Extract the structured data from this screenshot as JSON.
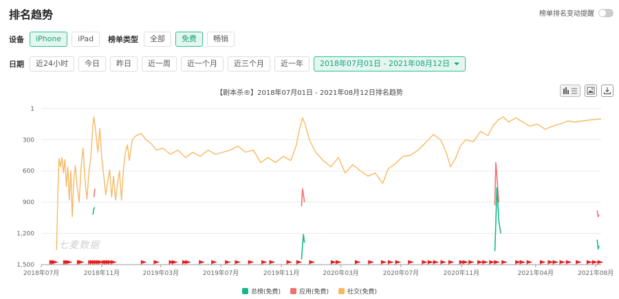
{
  "header": {
    "title": "排名趋势",
    "alert_label": "榜单排名变动提醒"
  },
  "device": {
    "label": "设备",
    "options": [
      "iPhone",
      "iPad"
    ],
    "active": 0
  },
  "list_type": {
    "label": "榜单类型",
    "options": [
      "全部",
      "免费",
      "畅销"
    ],
    "active": 1
  },
  "date": {
    "label": "日期",
    "options": [
      "近24小时",
      "今日",
      "昨日",
      "近一周",
      "近一个月",
      "近三个月",
      "近一年"
    ],
    "range": "2018年07月01日 - 2021年08月12日"
  },
  "watermark": "七麦数据",
  "icons": {
    "chart_toggle": "bar-list-toggle-icon",
    "image": "image-icon",
    "download": "download-icon"
  },
  "colors": {
    "accent": "#2ebd94",
    "overall": "#14b88a",
    "app": "#f0716e",
    "social": "#f8b862"
  },
  "chart_data": {
    "type": "line",
    "title": "【剧本杀®】2018年07月01日 - 2021年08月12日排名趋势",
    "xlabel": "",
    "ylabel": "",
    "y_inverted": true,
    "ylim": [
      1,
      1500
    ],
    "yticks": [
      1,
      300,
      600,
      900,
      1200,
      1500
    ],
    "ytick_labels": [
      "1",
      "300",
      "600",
      "900",
      "1,200",
      "1,500"
    ],
    "xticks": [
      "2018-07-01",
      "2018-11-01",
      "2019-03-01",
      "2019-07-01",
      "2019-11-01",
      "2020-03-01",
      "2020-07-01",
      "2020-11-01",
      "2021-04-01",
      "2021-08-01"
    ],
    "xtick_labels": [
      "2018年07月",
      "2018年11月",
      "2019年03月",
      "2019年07月",
      "2019年11月",
      "2020年03月",
      "2020年07月",
      "2020年11月",
      "2021年04月",
      "2021年08月"
    ],
    "xlim": [
      "2018-07-01",
      "2021-08-12"
    ],
    "grid": "horizontal",
    "legend_position": "bottom",
    "series": [
      {
        "name": "总榜(免费)",
        "color": "#14b88a",
        "segments": [
          [
            [
              "2018-10-14",
              1020
            ],
            [
              "2018-10-16",
              960
            ],
            [
              "2018-10-18",
              950
            ]
          ],
          [
            [
              "2019-12-12",
              1450
            ],
            [
              "2019-12-14",
              1320
            ],
            [
              "2019-12-16",
              1210
            ],
            [
              "2019-12-18",
              1290
            ]
          ],
          [
            [
              "2021-01-08",
              1370
            ],
            [
              "2021-01-10",
              1100
            ],
            [
              "2021-01-12",
              760
            ],
            [
              "2021-01-14",
              900
            ],
            [
              "2021-01-16",
              1080
            ],
            [
              "2021-01-20",
              1200
            ]
          ],
          [
            [
              "2021-08-04",
              1260
            ],
            [
              "2021-08-06",
              1350
            ],
            [
              "2021-08-08",
              1320
            ]
          ]
        ]
      },
      {
        "name": "应用(免费)",
        "color": "#f0716e",
        "segments": [
          [
            [
              "2018-10-16",
              850
            ],
            [
              "2018-10-18",
              770
            ]
          ],
          [
            [
              "2019-12-12",
              940
            ],
            [
              "2019-12-14",
              770
            ],
            [
              "2019-12-16",
              830
            ],
            [
              "2019-12-18",
              900
            ]
          ],
          [
            [
              "2021-01-08",
              930
            ],
            [
              "2021-01-10",
              520
            ],
            [
              "2021-01-12",
              640
            ],
            [
              "2021-01-14",
              780
            ],
            [
              "2021-01-16",
              900
            ]
          ],
          [
            [
              "2021-08-04",
              980
            ],
            [
              "2021-08-06",
              1040
            ],
            [
              "2021-08-08",
              1020
            ]
          ]
        ]
      },
      {
        "name": "社交(免费)",
        "color": "#f8b862",
        "points": [
          [
            "2018-08-01",
            1360
          ],
          [
            "2018-08-04",
            780
          ],
          [
            "2018-08-06",
            480
          ],
          [
            "2018-08-09",
            560
          ],
          [
            "2018-08-12",
            470
          ],
          [
            "2018-08-15",
            620
          ],
          [
            "2018-08-18",
            490
          ],
          [
            "2018-08-21",
            750
          ],
          [
            "2018-08-24",
            560
          ],
          [
            "2018-08-27",
            880
          ],
          [
            "2018-08-30",
            600
          ],
          [
            "2018-09-02",
            1040
          ],
          [
            "2018-09-05",
            700
          ],
          [
            "2018-09-08",
            550
          ],
          [
            "2018-09-12",
            750
          ],
          [
            "2018-09-16",
            900
          ],
          [
            "2018-09-20",
            560
          ],
          [
            "2018-09-24",
            380
          ],
          [
            "2018-09-28",
            700
          ],
          [
            "2018-10-02",
            870
          ],
          [
            "2018-10-06",
            600
          ],
          [
            "2018-10-10",
            460
          ],
          [
            "2018-10-14",
            160
          ],
          [
            "2018-10-16",
            80
          ],
          [
            "2018-10-20",
            230
          ],
          [
            "2018-10-24",
            420
          ],
          [
            "2018-10-28",
            190
          ],
          [
            "2018-11-01",
            480
          ],
          [
            "2018-11-05",
            640
          ],
          [
            "2018-11-09",
            830
          ],
          [
            "2018-11-13",
            700
          ],
          [
            "2018-11-17",
            590
          ],
          [
            "2018-11-21",
            850
          ],
          [
            "2018-11-25",
            650
          ],
          [
            "2018-11-29",
            880
          ],
          [
            "2018-12-03",
            720
          ],
          [
            "2018-12-07",
            600
          ],
          [
            "2018-12-11",
            880
          ],
          [
            "2018-12-15",
            580
          ],
          [
            "2018-12-19",
            420
          ],
          [
            "2018-12-23",
            350
          ],
          [
            "2018-12-27",
            500
          ],
          [
            "2019-01-02",
            300
          ],
          [
            "2019-01-10",
            260
          ],
          [
            "2019-01-20",
            240
          ],
          [
            "2019-01-30",
            300
          ],
          [
            "2019-02-10",
            340
          ],
          [
            "2019-02-20",
            400
          ],
          [
            "2019-03-05",
            380
          ],
          [
            "2019-03-20",
            440
          ],
          [
            "2019-04-05",
            400
          ],
          [
            "2019-04-20",
            470
          ],
          [
            "2019-05-05",
            420
          ],
          [
            "2019-05-20",
            460
          ],
          [
            "2019-06-05",
            400
          ],
          [
            "2019-06-20",
            440
          ],
          [
            "2019-07-05",
            420
          ],
          [
            "2019-07-20",
            400
          ],
          [
            "2019-08-05",
            360
          ],
          [
            "2019-08-20",
            420
          ],
          [
            "2019-09-05",
            400
          ],
          [
            "2019-09-20",
            520
          ],
          [
            "2019-10-05",
            470
          ],
          [
            "2019-10-20",
            520
          ],
          [
            "2019-11-05",
            460
          ],
          [
            "2019-11-20",
            500
          ],
          [
            "2019-12-01",
            360
          ],
          [
            "2019-12-08",
            200
          ],
          [
            "2019-12-14",
            90
          ],
          [
            "2019-12-20",
            160
          ],
          [
            "2019-12-28",
            300
          ],
          [
            "2020-01-10",
            420
          ],
          [
            "2020-01-25",
            500
          ],
          [
            "2020-02-10",
            560
          ],
          [
            "2020-02-25",
            470
          ],
          [
            "2020-03-10",
            620
          ],
          [
            "2020-03-25",
            540
          ],
          [
            "2020-04-10",
            600
          ],
          [
            "2020-04-25",
            650
          ],
          [
            "2020-05-10",
            620
          ],
          [
            "2020-05-25",
            720
          ],
          [
            "2020-06-05",
            580
          ],
          [
            "2020-06-20",
            530
          ],
          [
            "2020-07-05",
            460
          ],
          [
            "2020-07-20",
            450
          ],
          [
            "2020-08-05",
            400
          ],
          [
            "2020-08-20",
            330
          ],
          [
            "2020-09-05",
            250
          ],
          [
            "2020-09-20",
            300
          ],
          [
            "2020-10-01",
            420
          ],
          [
            "2020-10-10",
            560
          ],
          [
            "2020-10-20",
            480
          ],
          [
            "2020-10-30",
            360
          ],
          [
            "2020-11-10",
            300
          ],
          [
            "2020-11-25",
            320
          ],
          [
            "2020-12-10",
            220
          ],
          [
            "2020-12-25",
            260
          ],
          [
            "2021-01-05",
            160
          ],
          [
            "2021-01-15",
            110
          ],
          [
            "2021-01-25",
            80
          ],
          [
            "2021-02-05",
            130
          ],
          [
            "2021-02-20",
            90
          ],
          [
            "2021-03-05",
            130
          ],
          [
            "2021-03-20",
            170
          ],
          [
            "2021-04-05",
            150
          ],
          [
            "2021-04-20",
            200
          ],
          [
            "2021-05-05",
            170
          ],
          [
            "2021-05-20",
            150
          ],
          [
            "2021-06-05",
            120
          ],
          [
            "2021-06-20",
            130
          ],
          [
            "2021-07-05",
            120
          ],
          [
            "2021-07-20",
            110
          ],
          [
            "2021-08-12",
            100
          ]
        ]
      }
    ],
    "event_flags": [
      "2018-07-18",
      "2018-07-21",
      "2018-07-24",
      "2018-08-15",
      "2018-08-18",
      "2018-08-22",
      "2018-09-12",
      "2018-09-15",
      "2018-10-05",
      "2018-10-09",
      "2018-10-13",
      "2018-10-17",
      "2018-10-21",
      "2018-10-25",
      "2018-11-02",
      "2018-11-06",
      "2018-11-10",
      "2018-11-14",
      "2018-11-20",
      "2019-01-20",
      "2019-02-15",
      "2019-03-18",
      "2019-03-24",
      "2019-04-14",
      "2019-04-20",
      "2019-05-18",
      "2019-06-12",
      "2019-07-10",
      "2019-07-30",
      "2019-08-26",
      "2019-09-22",
      "2019-10-08",
      "2019-11-12",
      "2019-12-02",
      "2019-12-28",
      "2020-02-10",
      "2020-02-20",
      "2020-03-30",
      "2020-04-26",
      "2020-05-22",
      "2020-06-05",
      "2020-06-20",
      "2020-07-16",
      "2020-08-13",
      "2020-08-25",
      "2020-09-05",
      "2020-09-20",
      "2020-10-06",
      "2020-10-28",
      "2020-11-04",
      "2020-11-16",
      "2020-12-04",
      "2020-12-14",
      "2020-12-28",
      "2021-01-07",
      "2021-01-22",
      "2021-02-19",
      "2021-02-28",
      "2021-03-14",
      "2021-04-10",
      "2021-04-26",
      "2021-05-06",
      "2021-05-20",
      "2021-06-02",
      "2021-06-22",
      "2021-07-14",
      "2021-07-25",
      "2021-08-05"
    ]
  }
}
